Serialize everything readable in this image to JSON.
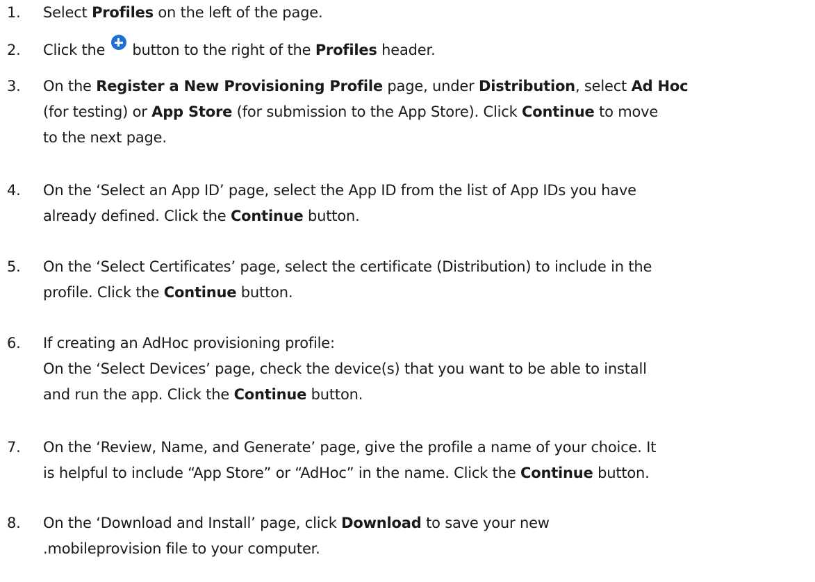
{
  "steps": [
    {
      "num": "1.",
      "lines": [
        [
          {
            "t": "Select "
          },
          {
            "t": "Profiles",
            "b": true
          },
          {
            "t": " on the left of the page."
          }
        ]
      ]
    },
    {
      "num": "2.",
      "lines": [
        [
          {
            "t": "Click the "
          },
          {
            "icon": "plus-circle-icon"
          },
          {
            "t": " button to the right of the "
          },
          {
            "t": "Profiles",
            "b": true
          },
          {
            "t": " header."
          }
        ]
      ]
    },
    {
      "num": "3.",
      "lines": [
        [
          {
            "t": "On the "
          },
          {
            "t": "Register a New Provisioning Profile",
            "b": true
          },
          {
            "t": " page, under "
          },
          {
            "t": "Distribution",
            "b": true
          },
          {
            "t": ", select "
          },
          {
            "t": "Ad Hoc",
            "b": true
          }
        ],
        [
          {
            "t": "(for testing) or "
          },
          {
            "t": "App Store",
            "b": true
          },
          {
            "t": " (for submission to the App Store). Click "
          },
          {
            "t": "Continue",
            "b": true
          },
          {
            "t": " to move"
          }
        ],
        [
          {
            "t": "to the next page."
          }
        ]
      ]
    },
    {
      "num": "4.",
      "lines": [
        [
          {
            "t": "On the ‘Select an App ID’ page, select the App ID from the list of App IDs you have"
          }
        ],
        [
          {
            "t": "already defined. Click the "
          },
          {
            "t": "Continue",
            "b": true
          },
          {
            "t": " button."
          }
        ]
      ]
    },
    {
      "num": "5.",
      "lines": [
        [
          {
            "t": "On the ‘Select Certificates’ page, select the certificate (Distribution) to include in the"
          }
        ],
        [
          {
            "t": "profile. Click the "
          },
          {
            "t": "Continue",
            "b": true
          },
          {
            "t": " button."
          }
        ]
      ]
    },
    {
      "num": "6.",
      "lines": [
        [
          {
            "t": "If creating an AdHoc provisioning profile:"
          }
        ],
        [
          {
            "t": "On the ‘Select Devices’ page, check the device(s) that you want to be able to install"
          }
        ],
        [
          {
            "t": "and run the app. Click the "
          },
          {
            "t": "Continue",
            "b": true
          },
          {
            "t": " button."
          }
        ]
      ]
    },
    {
      "num": "7.",
      "lines": [
        [
          {
            "t": "On the ‘Review, Name, and Generate’ page, give the profile a name of your choice. It"
          }
        ],
        [
          {
            "t": "is helpful to include “App Store” or “AdHoc” in the name. Click the "
          },
          {
            "t": "Continue",
            "b": true
          },
          {
            "t": " button."
          }
        ]
      ]
    },
    {
      "num": "8.",
      "lines": [
        [
          {
            "t": "On the ‘Download and Install’ page, click "
          },
          {
            "t": "Download",
            "b": true
          },
          {
            "t": " to save your new"
          }
        ],
        [
          {
            "t": ".mobileprovision file to your computer."
          }
        ]
      ]
    }
  ],
  "colors": {
    "text": "#1a1a1a",
    "icon": "#1f6fd6"
  }
}
